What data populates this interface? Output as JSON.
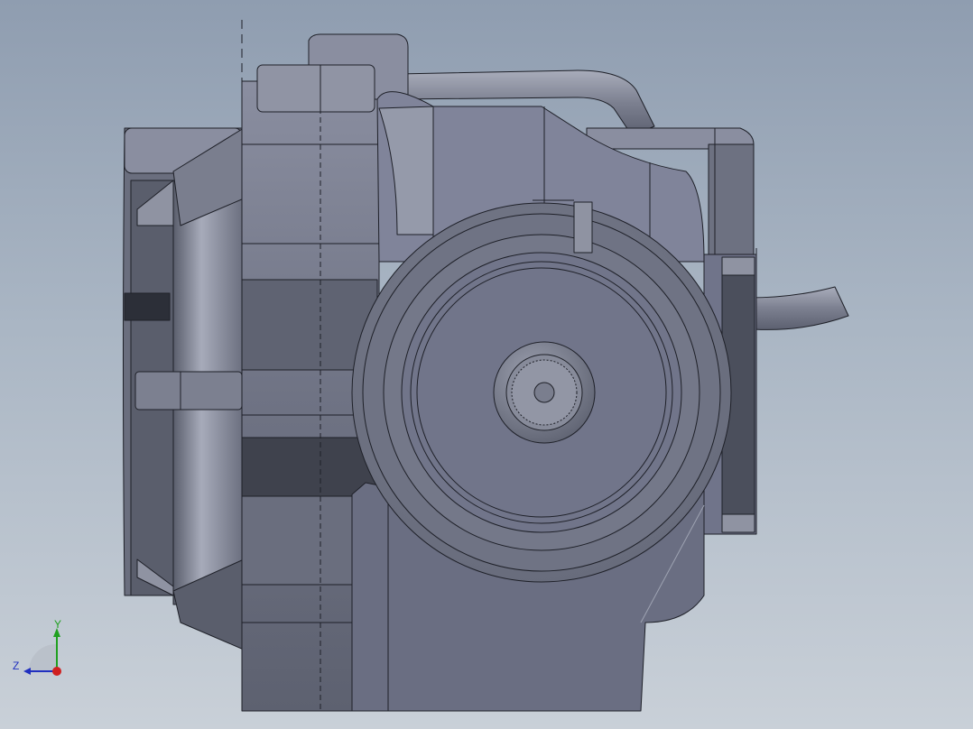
{
  "viewport": {
    "background_top": "#8f9db0",
    "background_bottom": "#c9d0d8",
    "part_color": "#6e7283",
    "edge_color": "#1e2028"
  },
  "triad": {
    "x_color": "#d02020",
    "y_color": "#20a020",
    "z_color": "#2030c0",
    "y_label": "Y",
    "z_label": "Z"
  }
}
